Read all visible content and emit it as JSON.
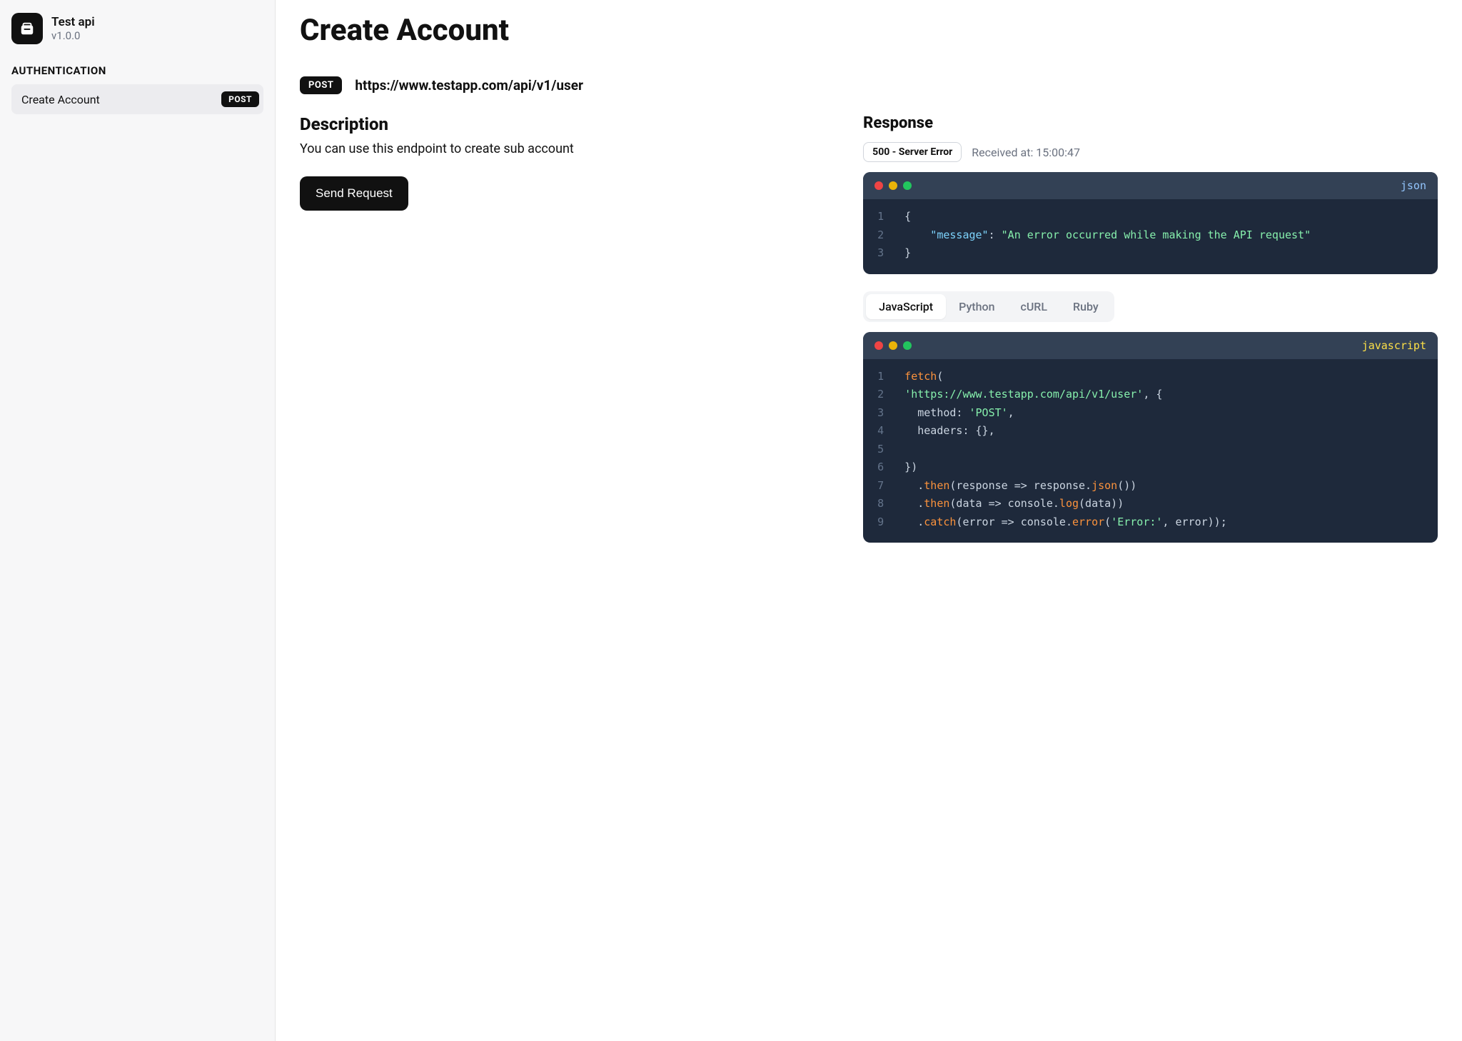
{
  "sidebar": {
    "app_name": "Test api",
    "version": "v1.0.0",
    "section_label": "AUTHENTICATION",
    "items": [
      {
        "label": "Create Account",
        "method": "POST"
      }
    ]
  },
  "page": {
    "title": "Create Account",
    "endpoint_method": "POST",
    "endpoint_url": "https://www.testapp.com/api/v1/user",
    "description_heading": "Description",
    "description_text": "You can use this endpoint to create sub account",
    "send_button": "Send Request"
  },
  "response": {
    "heading": "Response",
    "status_badge": "500 - Server Error",
    "received_label": "Received at: 15:00:47",
    "lang_label": "json",
    "body_lines": [
      [
        {
          "t": "punc",
          "v": "{"
        }
      ],
      [
        {
          "t": "indent",
          "v": "    "
        },
        {
          "t": "key",
          "v": "\"message\""
        },
        {
          "t": "punc",
          "v": ": "
        },
        {
          "t": "str",
          "v": "\"An error occurred while making the API request\""
        }
      ],
      [
        {
          "t": "punc",
          "v": "}"
        }
      ]
    ]
  },
  "code_tabs": {
    "items": [
      "JavaScript",
      "Python",
      "cURL",
      "Ruby"
    ],
    "active": 0
  },
  "code_sample": {
    "lang_label": "javascript",
    "lines": [
      [
        {
          "t": "fn",
          "v": "fetch"
        },
        {
          "t": "punc",
          "v": "("
        }
      ],
      [
        {
          "t": "str",
          "v": "'https://www.testapp.com/api/v1/user'"
        },
        {
          "t": "punc",
          "v": ", {"
        }
      ],
      [
        {
          "t": "arg",
          "v": "  method: "
        },
        {
          "t": "str",
          "v": "'POST'"
        },
        {
          "t": "punc",
          "v": ","
        }
      ],
      [
        {
          "t": "arg",
          "v": "  headers: {}"
        },
        {
          "t": "punc",
          "v": ","
        }
      ],
      [
        {
          "t": "arg",
          "v": ""
        }
      ],
      [
        {
          "t": "punc",
          "v": "})"
        }
      ],
      [
        {
          "t": "punc",
          "v": "  ."
        },
        {
          "t": "fn",
          "v": "then"
        },
        {
          "t": "punc",
          "v": "("
        },
        {
          "t": "arg",
          "v": "response => response."
        },
        {
          "t": "fn",
          "v": "json"
        },
        {
          "t": "punc",
          "v": "())"
        }
      ],
      [
        {
          "t": "punc",
          "v": "  ."
        },
        {
          "t": "fn",
          "v": "then"
        },
        {
          "t": "punc",
          "v": "("
        },
        {
          "t": "arg",
          "v": "data => console."
        },
        {
          "t": "fn",
          "v": "log"
        },
        {
          "t": "punc",
          "v": "("
        },
        {
          "t": "arg",
          "v": "data"
        },
        {
          "t": "punc",
          "v": "))"
        }
      ],
      [
        {
          "t": "punc",
          "v": "  ."
        },
        {
          "t": "fn",
          "v": "catch"
        },
        {
          "t": "punc",
          "v": "("
        },
        {
          "t": "arg",
          "v": "error => console."
        },
        {
          "t": "fn",
          "v": "error"
        },
        {
          "t": "punc",
          "v": "("
        },
        {
          "t": "str",
          "v": "'Error:'"
        },
        {
          "t": "punc",
          "v": ", "
        },
        {
          "t": "arg",
          "v": "error"
        },
        {
          "t": "punc",
          "v": "));"
        }
      ]
    ]
  }
}
